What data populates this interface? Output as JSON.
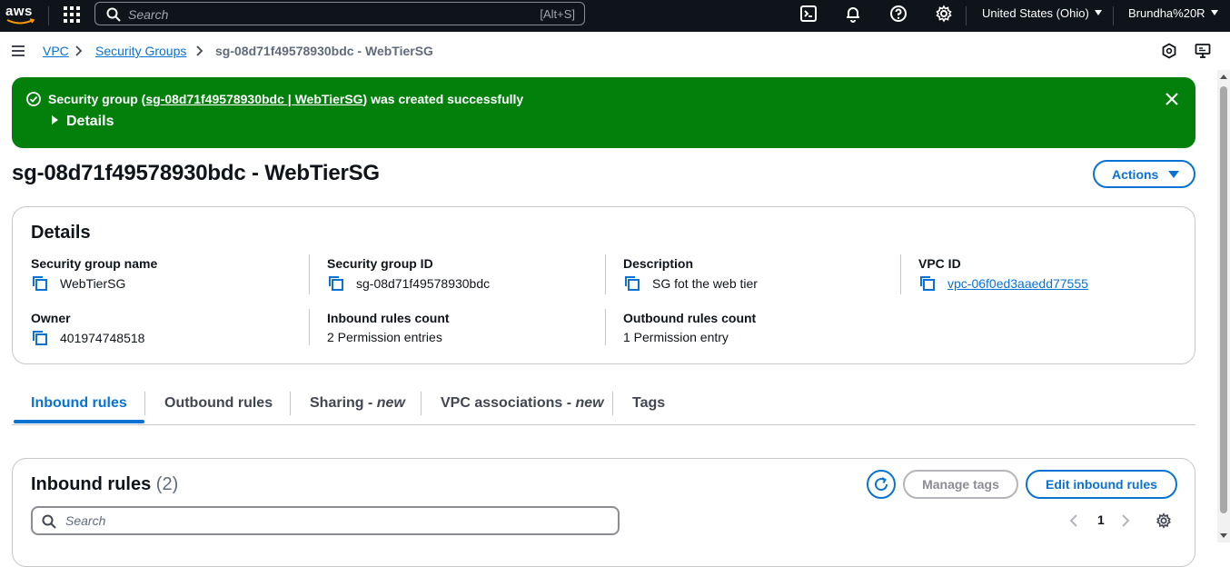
{
  "topnav": {
    "logo_text": "aws",
    "search_placeholder": "Search",
    "search_shortcut": "[Alt+S]",
    "region": "United States (Ohio)",
    "user": "Brundha%20R"
  },
  "breadcrumb": {
    "items": [
      "VPC",
      "Security Groups"
    ],
    "current": "sg-08d71f49578930bdc - WebTierSG"
  },
  "flash": {
    "prefix": "Security group (",
    "link": "sg-08d71f49578930bdc | WebTierSG",
    "suffix": ") was created successfully",
    "details_label": "Details",
    "color": "#037f0c"
  },
  "page": {
    "title": "sg-08d71f49578930bdc - WebTierSG",
    "actions_label": "Actions"
  },
  "details": {
    "heading": "Details",
    "sg_name_label": "Security group name",
    "sg_name": "WebTierSG",
    "sg_id_label": "Security group ID",
    "sg_id": "sg-08d71f49578930bdc",
    "description_label": "Description",
    "description": "SG fot the web tier",
    "vpc_id_label": "VPC ID",
    "vpc_id": "vpc-06f0ed3aaedd77555",
    "owner_label": "Owner",
    "owner": "401974748518",
    "inbound_count_label": "Inbound rules count",
    "inbound_count": "2 Permission entries",
    "outbound_count_label": "Outbound rules count",
    "outbound_count": "1 Permission entry"
  },
  "tabs": {
    "inbound": "Inbound rules",
    "outbound": "Outbound rules",
    "sharing": "Sharing - ",
    "sharing_new": "new",
    "vpc_assoc": "VPC associations - ",
    "vpc_assoc_new": "new",
    "tags": "Tags"
  },
  "inbound_panel": {
    "heading": "Inbound rules",
    "count": "(2)",
    "manage_tags": "Manage tags",
    "edit_inbound": "Edit inbound rules",
    "search_placeholder": "Search",
    "page": "1"
  },
  "colors": {
    "link": "#0972d3",
    "nav_bg": "#0f141a"
  }
}
